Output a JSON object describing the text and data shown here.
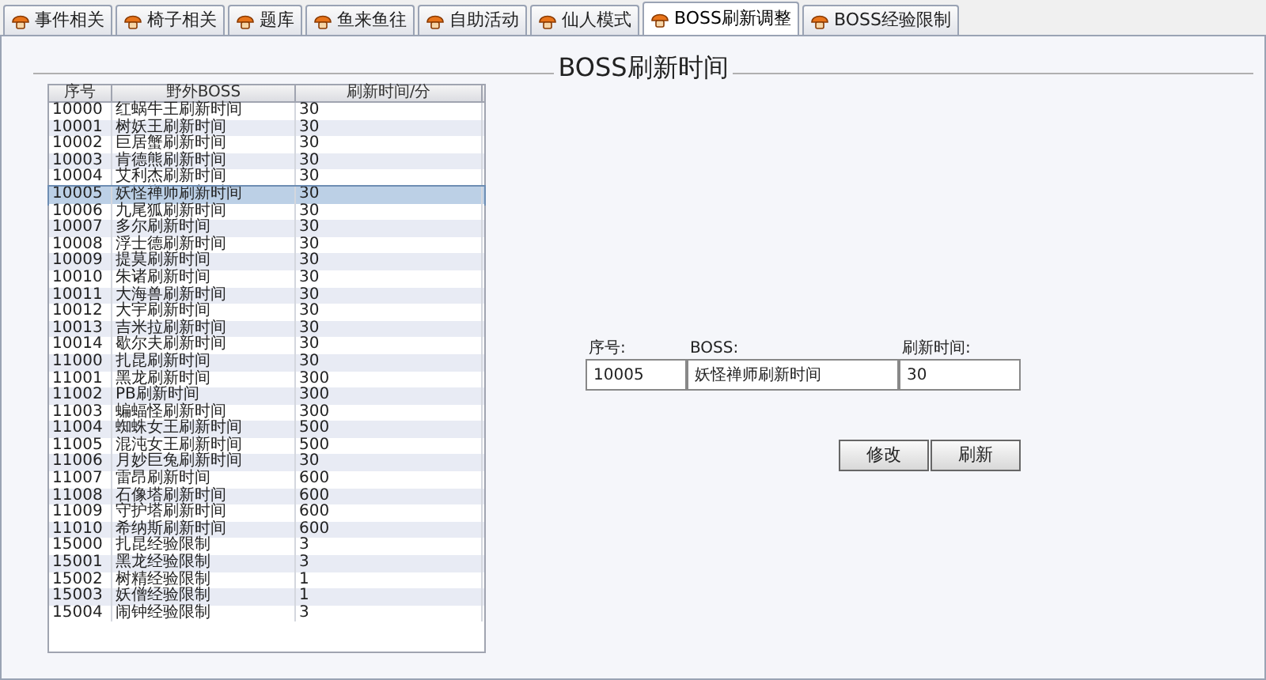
{
  "tabs": [
    {
      "label": "事件相关",
      "selected": false
    },
    {
      "label": "椅子相关",
      "selected": false
    },
    {
      "label": "题库",
      "selected": false
    },
    {
      "label": "鱼来鱼往",
      "selected": false
    },
    {
      "label": "自助活动",
      "selected": false
    },
    {
      "label": "仙人模式",
      "selected": false
    },
    {
      "label": "BOSS刷新调整",
      "selected": true
    },
    {
      "label": "BOSS经验限制",
      "selected": false
    }
  ],
  "group_title": "BOSS刷新时间",
  "table": {
    "columns": [
      "序号",
      "野外BOSS",
      "刷新时间/分"
    ],
    "rows": [
      {
        "cells": [
          "10000",
          "红蜗牛王刷新时间",
          "30"
        ],
        "selected": false
      },
      {
        "cells": [
          "10001",
          "树妖王刷新时间",
          "30"
        ],
        "selected": false
      },
      {
        "cells": [
          "10002",
          "巨居蟹刷新时间",
          "30"
        ],
        "selected": false
      },
      {
        "cells": [
          "10003",
          "肯德熊刷新时间",
          "30"
        ],
        "selected": false
      },
      {
        "cells": [
          "10004",
          "艾利杰刷新时间",
          "30"
        ],
        "selected": false
      },
      {
        "cells": [
          "10005",
          "妖怪禅师刷新时间",
          "30"
        ],
        "selected": true
      },
      {
        "cells": [
          "10006",
          "九尾狐刷新时间",
          "30"
        ],
        "selected": false
      },
      {
        "cells": [
          "10007",
          "多尔刷新时间",
          "30"
        ],
        "selected": false
      },
      {
        "cells": [
          "10008",
          "浮士德刷新时间",
          "30"
        ],
        "selected": false
      },
      {
        "cells": [
          "10009",
          "提莫刷新时间",
          "30"
        ],
        "selected": false
      },
      {
        "cells": [
          "10010",
          "朱诸刷新时间",
          "30"
        ],
        "selected": false
      },
      {
        "cells": [
          "10011",
          "大海兽刷新时间",
          "30"
        ],
        "selected": false
      },
      {
        "cells": [
          "10012",
          "大宇刷新时间",
          "30"
        ],
        "selected": false
      },
      {
        "cells": [
          "10013",
          "吉米拉刷新时间",
          "30"
        ],
        "selected": false
      },
      {
        "cells": [
          "10014",
          "歇尔夫刷新时间",
          "30"
        ],
        "selected": false
      },
      {
        "cells": [
          "11000",
          "扎昆刷新时间",
          "30"
        ],
        "selected": false
      },
      {
        "cells": [
          "11001",
          "黑龙刷新时间",
          "300"
        ],
        "selected": false
      },
      {
        "cells": [
          "11002",
          "PB刷新时间",
          "300"
        ],
        "selected": false
      },
      {
        "cells": [
          "11003",
          "蝙蝠怪刷新时间",
          "300"
        ],
        "selected": false
      },
      {
        "cells": [
          "11004",
          "蜘蛛女王刷新时间",
          "500"
        ],
        "selected": false
      },
      {
        "cells": [
          "11005",
          "混沌女王刷新时间",
          "500"
        ],
        "selected": false
      },
      {
        "cells": [
          "11006",
          "月妙巨兔刷新时间",
          "30"
        ],
        "selected": false
      },
      {
        "cells": [
          "11007",
          "雷昂刷新时间",
          "600"
        ],
        "selected": false
      },
      {
        "cells": [
          "11008",
          "石像塔刷新时间",
          "600"
        ],
        "selected": false
      },
      {
        "cells": [
          "11009",
          "守护塔刷新时间",
          "600"
        ],
        "selected": false
      },
      {
        "cells": [
          "11010",
          "希纳斯刷新时间",
          "600"
        ],
        "selected": false
      },
      {
        "cells": [
          "15000",
          "扎昆经验限制",
          "3"
        ],
        "selected": false
      },
      {
        "cells": [
          "15001",
          "黑龙经验限制",
          "3"
        ],
        "selected": false
      },
      {
        "cells": [
          "15002",
          "树精经验限制",
          "1"
        ],
        "selected": false
      },
      {
        "cells": [
          "15003",
          "妖僧经验限制",
          "1"
        ],
        "selected": false
      },
      {
        "cells": [
          "15004",
          "闹钟经验限制",
          "3"
        ],
        "selected": false
      }
    ]
  },
  "form": {
    "fields": [
      {
        "label": "序号:",
        "value": "10005"
      },
      {
        "label": "BOSS:",
        "value": "妖怪禅师刷新时间"
      },
      {
        "label": "刷新时间:",
        "value": "30"
      }
    ],
    "buttons": [
      "修改",
      "刷新"
    ]
  }
}
